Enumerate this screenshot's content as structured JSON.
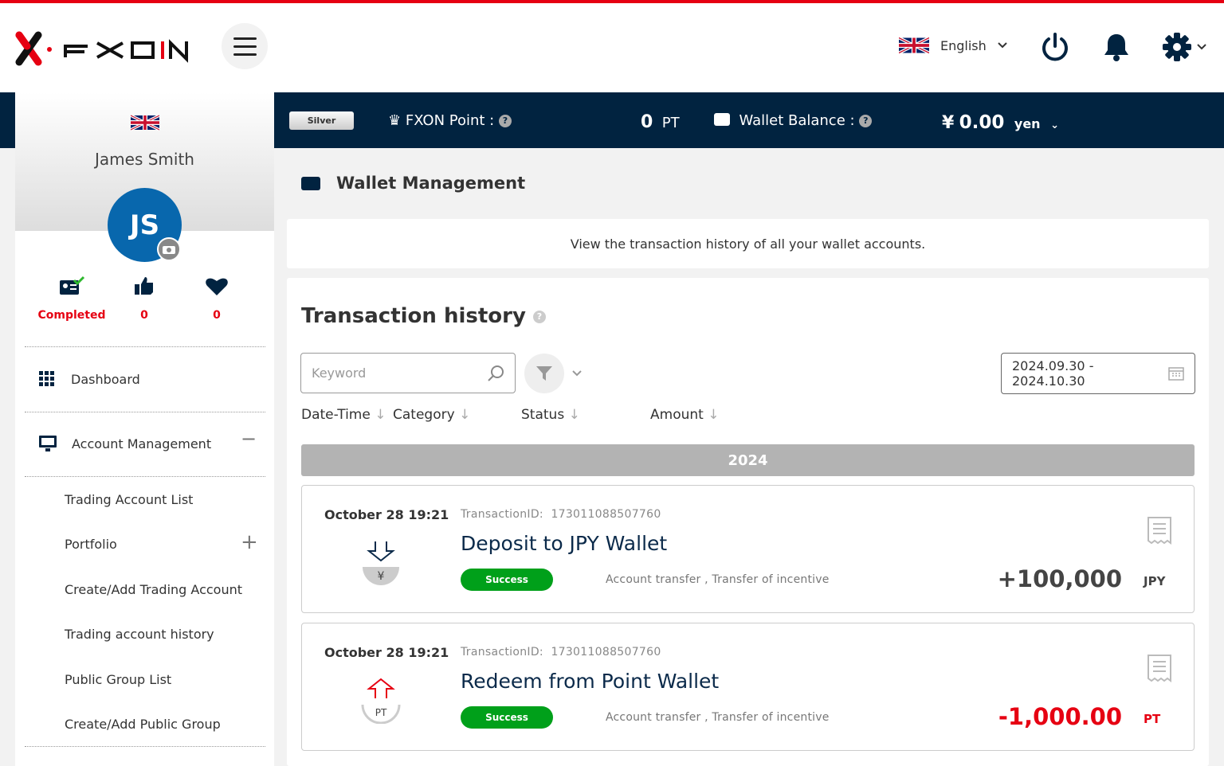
{
  "header": {
    "brand": "FXON",
    "language": "English",
    "icons": [
      "menu-icon",
      "uk-flag-icon",
      "chevron-down-icon",
      "power-icon",
      "bell-icon",
      "gear-icon"
    ]
  },
  "status_bar": {
    "rank": "Silver",
    "point_label": "FXON Point :",
    "point_value": "0",
    "point_unit": "PT",
    "wallet_label": "Wallet Balance :",
    "wallet_currency_symbol": "¥",
    "wallet_value": "0.00",
    "wallet_unit": "yen"
  },
  "profile": {
    "name": "James Smith",
    "initials": "JS",
    "avatar_color": "#0867ad",
    "stats": [
      {
        "icon": "id-card-check-icon",
        "label": "Completed"
      },
      {
        "icon": "thumbs-up-icon",
        "label": "0"
      },
      {
        "icon": "heart-icon",
        "label": "0"
      }
    ]
  },
  "sidebar": {
    "items": [
      {
        "label": "Dashboard",
        "icon": "grid-icon"
      },
      {
        "label": "Account Management",
        "icon": "monitor-icon",
        "toggle": "−"
      }
    ],
    "sub_items": [
      {
        "label": "Trading Account List"
      },
      {
        "label": "Portfolio",
        "toggle": "+"
      },
      {
        "label": "Create/Add Trading Account"
      },
      {
        "label": "Trading account history"
      },
      {
        "label": "Public Group List"
      },
      {
        "label": "Create/Add Public Group"
      }
    ]
  },
  "main": {
    "title": "Wallet Management",
    "description": "View the transaction history of all your wallet accounts.",
    "history": {
      "title": "Transaction history",
      "keyword_placeholder": "Keyword",
      "date_range": "2024.09.30 - 2024.10.30",
      "columns": [
        "Date-Time",
        "Category",
        "Status",
        "Amount"
      ],
      "year": "2024",
      "transactions": [
        {
          "datetime": "October 28 19:21",
          "id_label": "TransactionID:",
          "id": "173011088507760",
          "title": "Deposit to JPY Wallet",
          "status": "Success",
          "category": "Account transfer , Transfer of incentive",
          "amount": "+100,000",
          "currency": "JPY",
          "amount_color": "#444444",
          "icon": "deposit-yen-icon",
          "icon_text": "¥"
        },
        {
          "datetime": "October 28 19:21",
          "id_label": "TransactionID:",
          "id": "173011088507760",
          "title": "Redeem from Point Wallet",
          "status": "Success",
          "category": "Account transfer , Transfer of incentive",
          "amount": "-1,000.00",
          "currency": "PT",
          "amount_color": "#e60012",
          "icon": "redeem-point-icon",
          "icon_text": "PT"
        }
      ]
    }
  },
  "colors": {
    "brand_red": "#e60012",
    "navy": "#012340",
    "success": "#00a01a"
  }
}
